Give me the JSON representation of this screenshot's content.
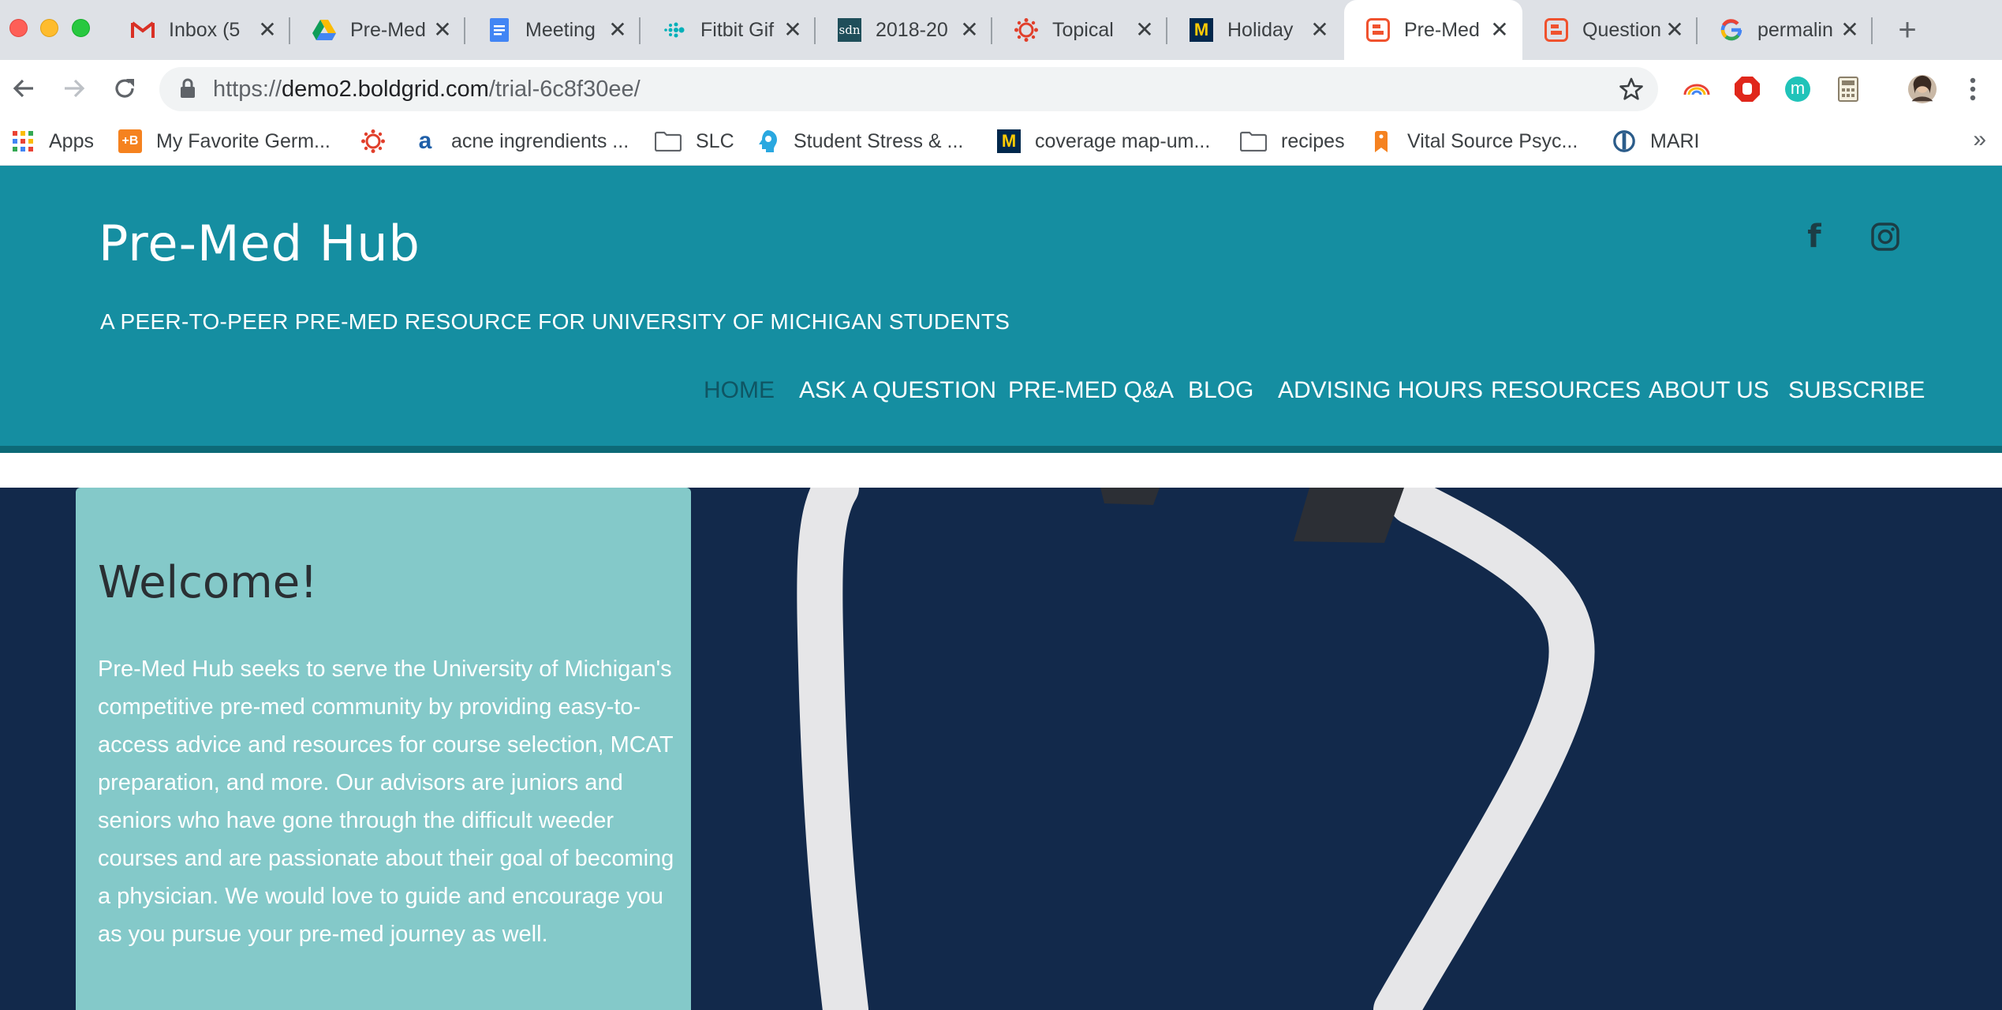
{
  "browser": {
    "tabs": [
      {
        "title": "Inbox (5",
        "icon": "gmail-icon"
      },
      {
        "title": "Pre-Med",
        "icon": "google-drive-icon"
      },
      {
        "title": "Meeting",
        "icon": "google-docs-icon"
      },
      {
        "title": "Fitbit Gif",
        "icon": "fitbit-icon"
      },
      {
        "title": "2018-20",
        "icon": "sdn-icon"
      },
      {
        "title": "Topical",
        "icon": "canvas-icon"
      },
      {
        "title": "Holiday",
        "icon": "umich-icon"
      },
      {
        "title": "Pre-Med",
        "icon": "boldgrid-icon",
        "active": true
      },
      {
        "title": "Question",
        "icon": "boldgrid-icon"
      },
      {
        "title": "permalin",
        "icon": "google-icon"
      }
    ],
    "close_glyph": "✕",
    "new_tab_glyph": "+",
    "url_scheme": "https://",
    "url_host": "demo2.boldgrid.com",
    "url_path": "/trial-6c8f30ee/",
    "sdn_text": "sdn",
    "umich_text": "M",
    "bookmarks": [
      {
        "label": "Apps",
        "icon": "apps-grid-icon"
      },
      {
        "label": "My Favorite Germ...",
        "icon": "plus-b-icon",
        "badge": "+B"
      },
      {
        "label": "",
        "icon": "canvas-icon"
      },
      {
        "label": "acne ingrendients ...",
        "icon": "amazon-icon",
        "badge": "a"
      },
      {
        "label": "SLC",
        "icon": "folder-icon"
      },
      {
        "label": "Student Stress & ...",
        "icon": "brain-icon"
      },
      {
        "label": "coverage map-um...",
        "icon": "umich-icon",
        "badge": "M"
      },
      {
        "label": "recipes",
        "icon": "folder-icon"
      },
      {
        "label": "Vital Source Psyc...",
        "icon": "bookmark-tag-icon"
      },
      {
        "label": "MARI",
        "icon": "mari-icon"
      }
    ],
    "bookmarks_more": "»",
    "extension_badge": "m"
  },
  "site": {
    "title": "Pre-Med Hub",
    "tagline": "A PEER-TO-PEER PRE-MED RESOURCE FOR UNIVERSITY OF MICHIGAN STUDENTS",
    "nav": [
      {
        "label": "HOME",
        "current": true
      },
      {
        "label": "ASK A QUESTION"
      },
      {
        "label": "PRE-MED Q&A"
      },
      {
        "label": "BLOG"
      },
      {
        "label": "ADVISING HOURS"
      },
      {
        "label": "RESOURCES"
      },
      {
        "label": "ABOUT US"
      },
      {
        "label": "SUBSCRIBE"
      }
    ],
    "social": [
      "facebook-icon",
      "instagram-icon"
    ],
    "facebook_glyph": "f"
  },
  "welcome": {
    "title": "Welcome!",
    "text": "Pre-Med Hub seeks to serve the University of Michigan's competitive pre-med community by providing easy-to-access advice and resources for course selection, MCAT preparation, and more. Our advisors are juniors and seniors who have gone through the difficult weeder courses and are passionate about their goal of becoming a physician. We would love to guide and encourage you as you pursue your pre-med journey as well."
  },
  "colors": {
    "header_bg": "#158ea1",
    "header_stripe": "#0d6a77",
    "hero_bg": "#12294b",
    "welcome_card_bg": "#84c9c9",
    "nav_current": "#0f5563"
  }
}
